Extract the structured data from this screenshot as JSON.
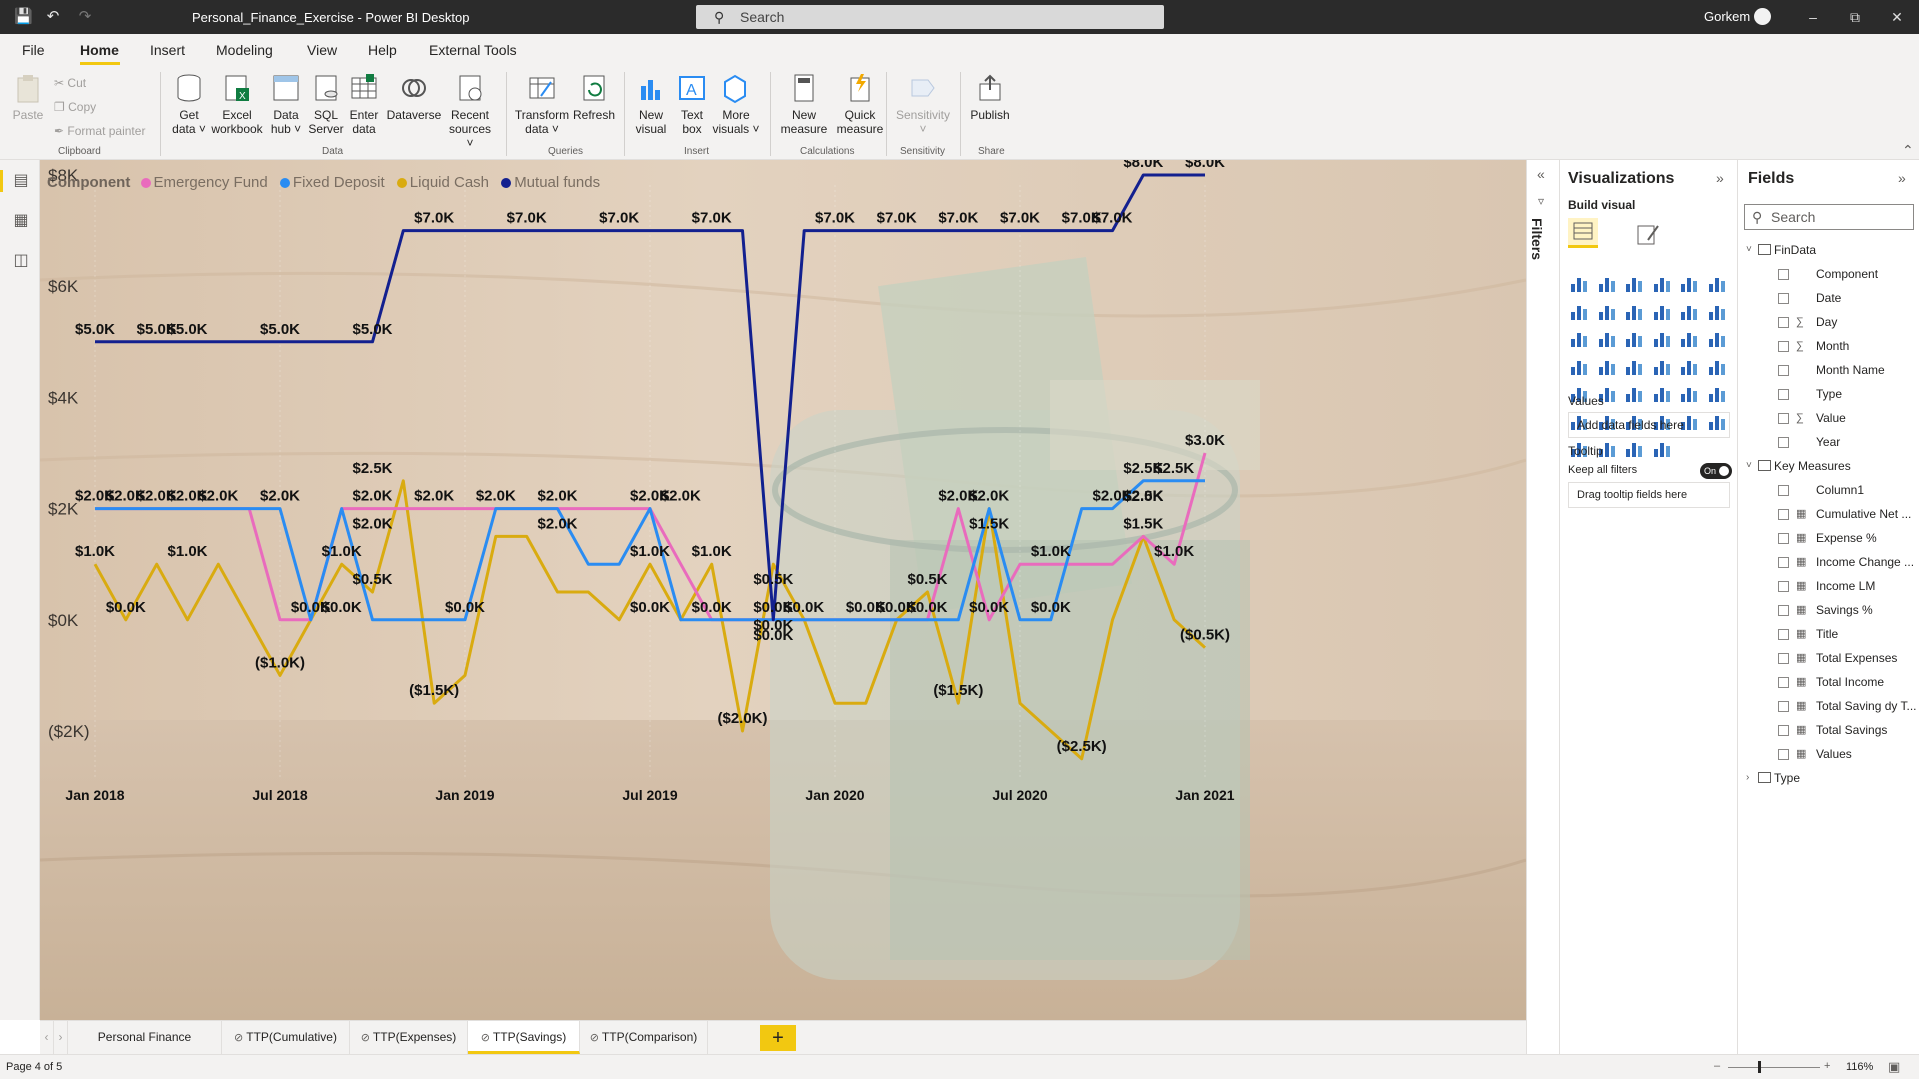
{
  "titlebar": {
    "title": "Personal_Finance_Exercise - Power BI Desktop",
    "search_placeholder": "Search",
    "user": "Gorkem"
  },
  "menu": {
    "items": [
      "File",
      "Home",
      "Insert",
      "Modeling",
      "View",
      "Help",
      "External Tools"
    ],
    "active": "Home"
  },
  "ribbon": {
    "clipboard": {
      "paste": "Paste",
      "cut": "Cut",
      "copy": "Copy",
      "format_painter": "Format painter",
      "group": "Clipboard"
    },
    "data": {
      "get_data": "Get",
      "get_data2": "data",
      "excel": "Excel",
      "excel2": "workbook",
      "hub": "Data",
      "hub2": "hub",
      "sql": "SQL",
      "sql2": "Server",
      "enter": "Enter",
      "enter2": "data",
      "dataverse": "Dataverse",
      "recent": "Recent",
      "recent2": "sources",
      "group": "Data"
    },
    "queries": {
      "transform": "Transform",
      "transform2": "data",
      "refresh": "Refresh",
      "group": "Queries"
    },
    "insert": {
      "new_visual": "New",
      "new_visual2": "visual",
      "text_box": "Text",
      "text_box2": "box",
      "more": "More",
      "more2": "visuals",
      "group": "Insert"
    },
    "calc": {
      "new_measure": "New",
      "new_measure2": "measure",
      "quick": "Quick",
      "quick2": "measure",
      "group": "Calculations"
    },
    "sensitivity": {
      "label": "Sensitivity",
      "group": "Sensitivity"
    },
    "share": {
      "publish": "Publish",
      "group": "Share"
    }
  },
  "colors": {
    "emergency": "#e96bbd",
    "fixed": "#2a8cf2",
    "liquid": "#d9ab10",
    "mutual": "#13208f",
    "accent": "#f2c811"
  },
  "chart_data": {
    "type": "line",
    "legend_title": "Component",
    "x": [
      "2018-01",
      "2018-02",
      "2018-03",
      "2018-04",
      "2018-05",
      "2018-06",
      "2018-07",
      "2018-08",
      "2018-09",
      "2018-10",
      "2018-11",
      "2018-12",
      "2019-01",
      "2019-02",
      "2019-03",
      "2019-04",
      "2019-05",
      "2019-06",
      "2019-07",
      "2019-08",
      "2019-09",
      "2019-10",
      "2019-11",
      "2019-12",
      "2020-01",
      "2020-02",
      "2020-03",
      "2020-04",
      "2020-05",
      "2020-06",
      "2020-07",
      "2020-08",
      "2020-09",
      "2020-10",
      "2020-11",
      "2020-12",
      "2021-01"
    ],
    "x_ticks": [
      "Jan 2018",
      "Jul 2018",
      "Jan 2019",
      "Jul 2019",
      "Jan 2020",
      "Jul 2020",
      "Jan 2021"
    ],
    "y_ticks": [
      "$8K",
      "$6K",
      "$4K",
      "$2K",
      "$0K",
      "($2K)"
    ],
    "ylim": [
      -2000,
      8000
    ],
    "series": [
      {
        "name": "Emergency Fund",
        "values": [
          2000,
          2000,
          2000,
          2000,
          2000,
          2000,
          0,
          0,
          2000,
          2000,
          2000,
          2000,
          2000,
          2000,
          2000,
          2000,
          2000,
          2000,
          2000,
          1000,
          0,
          0,
          0,
          0,
          0,
          0,
          0,
          0,
          2000,
          0,
          1000,
          1000,
          1000,
          1000,
          1500,
          1000,
          3000
        ]
      },
      {
        "name": "Fixed Deposit",
        "values": [
          2000,
          2000,
          2000,
          2000,
          2000,
          2000,
          2000,
          0,
          2000,
          0,
          0,
          0,
          0,
          2000,
          2000,
          2000,
          1000,
          1000,
          2000,
          0,
          0,
          0,
          0,
          0,
          0,
          0,
          0,
          0,
          0,
          2000,
          0,
          0,
          2000,
          2000,
          2500,
          2500,
          2500
        ]
      },
      {
        "name": "Liquid Cash",
        "values": [
          1000,
          0,
          1000,
          0,
          1000,
          0,
          -1000,
          0,
          1000,
          500,
          2500,
          -1500,
          -1000,
          1500,
          1500,
          500,
          500,
          0,
          1000,
          0,
          1000,
          -2000,
          1000,
          0,
          -1500,
          -1500,
          0,
          500,
          -1500,
          2000,
          -1500,
          -2000,
          -2500,
          0,
          1500,
          0,
          -500
        ]
      },
      {
        "name": "Mutual funds",
        "values": [
          5000,
          5000,
          5000,
          5000,
          5000,
          5000,
          5000,
          5000,
          5000,
          5000,
          7000,
          7000,
          7000,
          7000,
          7000,
          7000,
          7000,
          7000,
          7000,
          7000,
          7000,
          7000,
          0,
          7000,
          7000,
          7000,
          7000,
          7000,
          7000,
          7000,
          7000,
          7000,
          7000,
          7000,
          8000,
          8000,
          8000
        ]
      }
    ],
    "data_labels": [
      {
        "x": "2018-01",
        "value": 5000,
        "text": "$5.0K"
      },
      {
        "x": "2018-03",
        "value": 5000,
        "text": "$5.0K"
      },
      {
        "x": "2018-04",
        "value": 5000,
        "text": "$5.0K"
      },
      {
        "x": "2018-07",
        "value": 5000,
        "text": "$5.0K"
      },
      {
        "x": "2018-10",
        "value": 5000,
        "text": "$5.0K"
      },
      {
        "x": "2018-12",
        "value": 7000,
        "text": "$7.0K"
      },
      {
        "x": "2019-03",
        "value": 7000,
        "text": "$7.0K"
      },
      {
        "x": "2019-06",
        "value": 7000,
        "text": "$7.0K"
      },
      {
        "x": "2019-09",
        "value": 7000,
        "text": "$7.0K"
      },
      {
        "x": "2020-01",
        "value": 7000,
        "text": "$7.0K"
      },
      {
        "x": "2020-03",
        "value": 7000,
        "text": "$7.0K"
      },
      {
        "x": "2020-05",
        "value": 7000,
        "text": "$7.0K"
      },
      {
        "x": "2020-07",
        "value": 7000,
        "text": "$7.0K"
      },
      {
        "x": "2020-09",
        "value": 7000,
        "text": "$7.0K"
      },
      {
        "x": "2020-10",
        "value": 7000,
        "text": "$7.0K"
      },
      {
        "x": "2020-11",
        "value": 8000,
        "text": "$8.0K"
      },
      {
        "x": "2021-01",
        "value": 8000,
        "text": "$8.0K"
      },
      {
        "x": "2018-01",
        "value": 2000,
        "text": "$2.0K"
      },
      {
        "x": "2018-02",
        "value": 2000,
        "text": "$2.0K"
      },
      {
        "x": "2018-03",
        "value": 2000,
        "text": "$2.0K"
      },
      {
        "x": "2018-04",
        "value": 2000,
        "text": "$2.0K"
      },
      {
        "x": "2018-05",
        "value": 2000,
        "text": "$2.0K"
      },
      {
        "x": "2018-07",
        "value": 2000,
        "text": "$2.0K"
      },
      {
        "x": "2018-10",
        "value": 2000,
        "text": "$2.0K"
      },
      {
        "x": "2018-10",
        "value": 2000,
        "text": "$2.0K"
      },
      {
        "x": "2018-12",
        "value": 2000,
        "text": "$2.0K"
      },
      {
        "x": "2019-02",
        "value": 2000,
        "text": "$2.0K"
      },
      {
        "x": "2019-04",
        "value": 2000,
        "text": "$2.0K"
      },
      {
        "x": "2019-04",
        "value": 2000,
        "text": "$2.0K"
      },
      {
        "x": "2019-07",
        "value": 2000,
        "text": "$2.0K"
      },
      {
        "x": "2019-08",
        "value": 2000,
        "text": "$2.0K"
      },
      {
        "x": "2020-05",
        "value": 2000,
        "text": "$2.0K"
      },
      {
        "x": "2020-06",
        "value": 2000,
        "text": "$2.0K"
      },
      {
        "x": "2020-10",
        "value": 2000,
        "text": "$2.0K"
      },
      {
        "x": "2020-11",
        "value": 2000,
        "text": "$2.0K"
      },
      {
        "x": "2020-11",
        "value": 2500,
        "text": "$2.5K"
      },
      {
        "x": "2020-11",
        "value": 2500,
        "text": "$2.5K"
      },
      {
        "x": "2020-12",
        "value": 2500,
        "text": "$2.5K"
      },
      {
        "x": "2021-01",
        "value": 3000,
        "text": "$3.0K"
      },
      {
        "x": "2018-10",
        "value": 2500,
        "text": "$2.5K"
      },
      {
        "x": "2018-01",
        "value": 1000,
        "text": "$1.0K"
      },
      {
        "x": "2018-04",
        "value": 1000,
        "text": "$1.0K"
      },
      {
        "x": "2018-09",
        "value": 1000,
        "text": "$1.0K"
      },
      {
        "x": "2019-07",
        "value": 1000,
        "text": "$1.0K"
      },
      {
        "x": "2019-09",
        "value": 1000,
        "text": "$1.0K"
      },
      {
        "x": "2020-08",
        "value": 1000,
        "text": "$1.0K"
      },
      {
        "x": "2020-12",
        "value": 1000,
        "text": "$1.0K"
      },
      {
        "x": "2020-06",
        "value": 1500,
        "text": "$1.5K"
      },
      {
        "x": "2020-11",
        "value": 1500,
        "text": "$1.5K"
      },
      {
        "x": "2018-10",
        "value": 500,
        "text": "$0.5K"
      },
      {
        "x": "2019-11",
        "value": 500,
        "text": "$0.5K"
      },
      {
        "x": "2020-04",
        "value": 500,
        "text": "$0.5K"
      },
      {
        "x": "2018-02",
        "value": 0,
        "text": "$0.0K"
      },
      {
        "x": "2018-08",
        "value": 0,
        "text": "$0.0K"
      },
      {
        "x": "2018-09",
        "value": 0,
        "text": "$0.0K"
      },
      {
        "x": "2019-01",
        "value": 0,
        "text": "$0.0K"
      },
      {
        "x": "2019-07",
        "value": 0,
        "text": "$0.0K"
      },
      {
        "x": "2019-09",
        "value": 0,
        "text": "$0.0K"
      },
      {
        "x": "2019-11",
        "value": 0,
        "text": "$0.0K"
      },
      {
        "x": "2019-11",
        "value": 0,
        "text": "$0.0K"
      },
      {
        "x": "2019-12",
        "value": 0,
        "text": "$0.0K"
      },
      {
        "x": "2020-02",
        "value": 0,
        "text": "$0.0K"
      },
      {
        "x": "2020-03",
        "value": 0,
        "text": "$0.0K"
      },
      {
        "x": "2020-04",
        "value": 0,
        "text": "$0.0K"
      },
      {
        "x": "2020-06",
        "value": 0,
        "text": "$0.0K"
      },
      {
        "x": "2020-08",
        "value": 0,
        "text": "$0.0K"
      },
      {
        "x": "2019-11",
        "value": 0,
        "text": "$0.0K"
      },
      {
        "x": "2018-07",
        "value": -1000,
        "text": "($1.0K)"
      },
      {
        "x": "2018-12",
        "value": -1500,
        "text": "($1.5K)"
      },
      {
        "x": "2020-05",
        "value": -1500,
        "text": "($1.5K)"
      },
      {
        "x": "2019-10",
        "value": -2000,
        "text": "($2.0K)"
      },
      {
        "x": "2020-09",
        "value": -2500,
        "text": "($2.5K)"
      },
      {
        "x": "2021-01",
        "value": -500,
        "text": "($0.5K)"
      }
    ]
  },
  "page_tabs": [
    {
      "label": "Personal Finance Dashboard",
      "hidden": false,
      "active": false
    },
    {
      "label": "TTP(Cumulative)",
      "hidden": true,
      "active": false
    },
    {
      "label": "TTP(Expenses)",
      "hidden": true,
      "active": false
    },
    {
      "label": "TTP(Savings)",
      "hidden": true,
      "active": true
    },
    {
      "label": "TTP(Comparison)",
      "hidden": true,
      "active": false
    }
  ],
  "status": {
    "page": "Page 4 of 5",
    "zoom": "116%"
  },
  "filters": {
    "label": "Filters"
  },
  "viz": {
    "title": "Visualizations",
    "build": "Build visual",
    "values": "Values",
    "values_well": "Add data fields here",
    "tooltip": "Tooltip",
    "keep_filters": "Keep all filters",
    "toggle": "On",
    "tooltip_well": "Drag tooltip fields here"
  },
  "fields": {
    "title": "Fields",
    "search_placeholder": "Search",
    "tables": [
      {
        "name": "FinData",
        "expanded": true,
        "fields": [
          {
            "name": "Component",
            "type": ""
          },
          {
            "name": "Date",
            "type": ""
          },
          {
            "name": "Day",
            "type": "∑"
          },
          {
            "name": "Month",
            "type": "∑"
          },
          {
            "name": "Month Name",
            "type": ""
          },
          {
            "name": "Type",
            "type": ""
          },
          {
            "name": "Value",
            "type": "∑"
          },
          {
            "name": "Year",
            "type": ""
          }
        ]
      },
      {
        "name": "Key Measures",
        "expanded": true,
        "fields": [
          {
            "name": "Column1",
            "type": ""
          },
          {
            "name": "Cumulative Net ...",
            "type": "m"
          },
          {
            "name": "Expense %",
            "type": "m"
          },
          {
            "name": "Income Change ...",
            "type": "m"
          },
          {
            "name": "Income LM",
            "type": "m"
          },
          {
            "name": "Savings %",
            "type": "m"
          },
          {
            "name": "Title",
            "type": "m"
          },
          {
            "name": "Total Expenses",
            "type": "m"
          },
          {
            "name": "Total Income",
            "type": "m"
          },
          {
            "name": "Total Saving dy T...",
            "type": "m"
          },
          {
            "name": "Total Savings",
            "type": "m"
          },
          {
            "name": "Values",
            "type": "m"
          }
        ]
      },
      {
        "name": "Type",
        "expanded": false,
        "fields": []
      }
    ]
  }
}
